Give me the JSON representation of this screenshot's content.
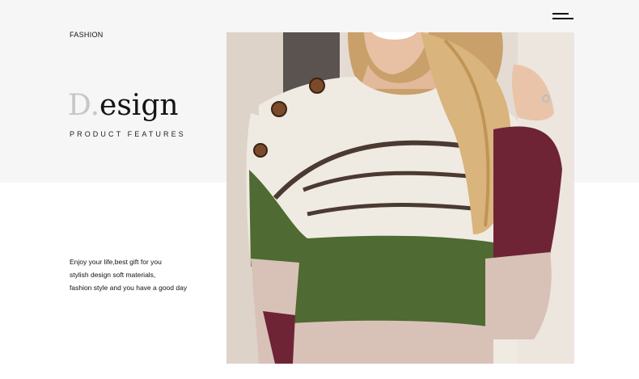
{
  "header": {
    "menu_icon": "hamburger-menu-icon"
  },
  "intro": {
    "category": "FASHION",
    "title_first_letter": "D.",
    "title_rest": "esign",
    "subtitle": "PRODUCT FEATURES"
  },
  "description": {
    "lines": [
      "Enjoy your life,best gift for you",
      "stylish design soft materials,",
      "fashion style and you have a good day"
    ]
  },
  "product_photo": {
    "subject": "colorblock-striped-knit-sweater",
    "colors": {
      "background": "#f6f6f6",
      "cream": "#efebe2",
      "stripe": "#4a3a32",
      "green": "#4f6a32",
      "blush": "#d8c2b8",
      "burgundy": "#6e2435",
      "hair": "#d9b47c"
    }
  }
}
